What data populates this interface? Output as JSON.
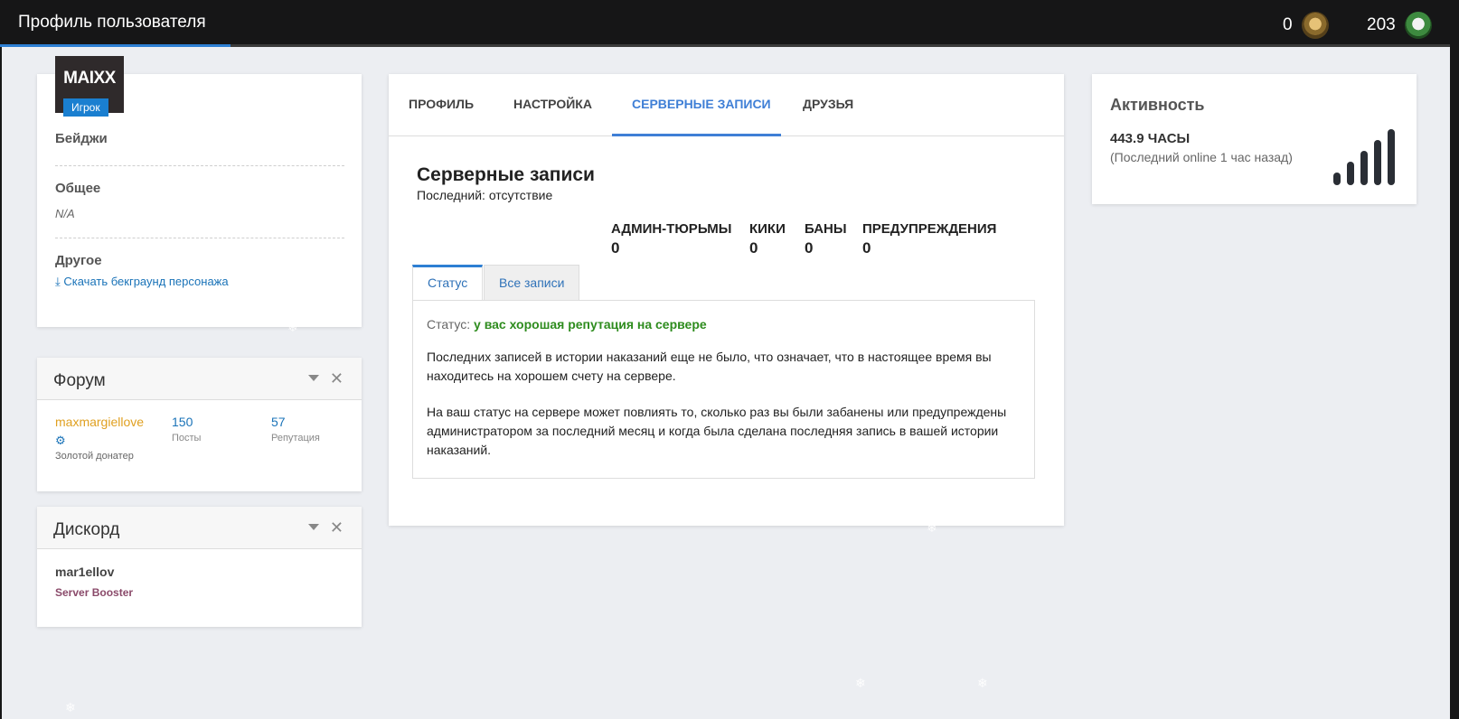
{
  "topbar": {
    "title": "Профиль пользователя",
    "coins_a": "0",
    "coins_b": "203"
  },
  "profile": {
    "name": "MAIXX",
    "role": "Игрок",
    "badges_label": "Бейджи",
    "general_label": "Общее",
    "general_value": "N/A",
    "other_label": "Другое",
    "download_link": "Скачать бекграунд персонажа"
  },
  "forum": {
    "title": "Форум",
    "username": "maxmargiellove",
    "rank": "Золотой донатер",
    "posts_value": "150",
    "posts_label": "Посты",
    "rep_value": "57",
    "rep_label": "Репутация"
  },
  "discord": {
    "title": "Дискорд",
    "username": "mar1ellov",
    "role": "Server Booster"
  },
  "tabs": {
    "profile": "ПРОФИЛЬ",
    "settings": "НАСТРОЙКА",
    "records": "СЕРВЕРНЫЕ ЗАПИСИ",
    "friends": "ДРУЗЬЯ"
  },
  "records": {
    "title": "Серверные записи",
    "subtitle": "Последний: отсутствие",
    "stats": [
      {
        "label": "АДМИН-ТЮРЬМЫ",
        "value": "0"
      },
      {
        "label": "КИКИ",
        "value": "0"
      },
      {
        "label": "БАНЫ",
        "value": "0"
      },
      {
        "label": "ПРЕДУПРЕЖДЕНИЯ",
        "value": "0"
      }
    ],
    "subtab_status": "Статус",
    "subtab_all": "Все записи",
    "status_prefix": "Статус:",
    "status_value": "у вас хорошая репутация на сервере",
    "para1": "Последних записей в истории наказаний еще не было, что означает, что в настоящее время вы находитесь на хорошем счету на сервере.",
    "para2": "На ваш статус на сервере может повлиять то, сколько раз вы были забанены или предупреждены администратором за последний месяц и когда была сделана последняя запись в вашей истории наказаний."
  },
  "activity": {
    "title": "Активность",
    "hours": "443.9 ЧАСЫ",
    "last_online": "(Последний online 1 час назад)"
  },
  "colors": {
    "accent": "#3f7fd6",
    "good": "#2e8c1e",
    "forum_user": "#e0a020",
    "booster": "#8a4a6a"
  }
}
